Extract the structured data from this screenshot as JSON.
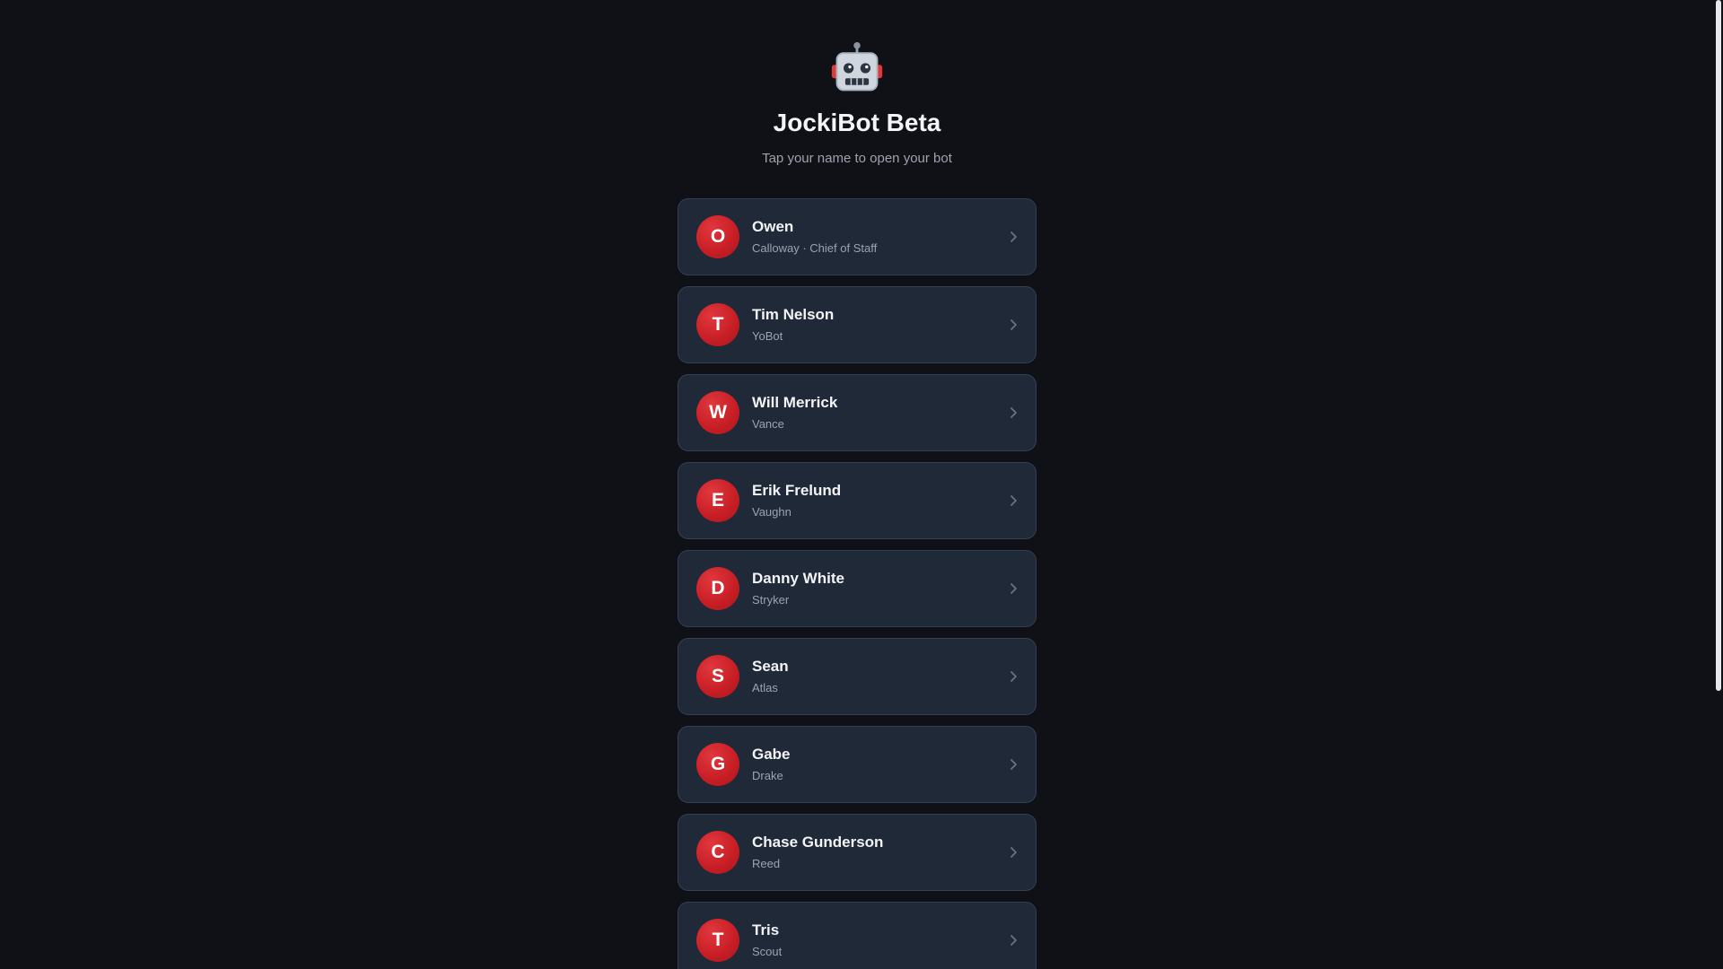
{
  "header": {
    "logo_icon": "robot-icon",
    "title": "JockiBot Beta",
    "subtitle": "Tap your name to open your bot"
  },
  "colors": {
    "background": "#0f1117",
    "card": "#1f2937",
    "card_border": "#334155",
    "avatar": "#c91f26",
    "text_primary": "#f3f4f6",
    "text_secondary": "#9ca3af"
  },
  "users": [
    {
      "initial": "O",
      "name": "Owen",
      "subtitle": "Calloway · Chief of Staff"
    },
    {
      "initial": "T",
      "name": "Tim Nelson",
      "subtitle": "YoBot"
    },
    {
      "initial": "W",
      "name": "Will Merrick",
      "subtitle": "Vance"
    },
    {
      "initial": "E",
      "name": "Erik Frelund",
      "subtitle": "Vaughn"
    },
    {
      "initial": "D",
      "name": "Danny White",
      "subtitle": "Stryker"
    },
    {
      "initial": "S",
      "name": "Sean",
      "subtitle": "Atlas"
    },
    {
      "initial": "G",
      "name": "Gabe",
      "subtitle": "Drake"
    },
    {
      "initial": "C",
      "name": "Chase Gunderson",
      "subtitle": "Reed"
    },
    {
      "initial": "T",
      "name": "Tris",
      "subtitle": "Scout"
    }
  ]
}
